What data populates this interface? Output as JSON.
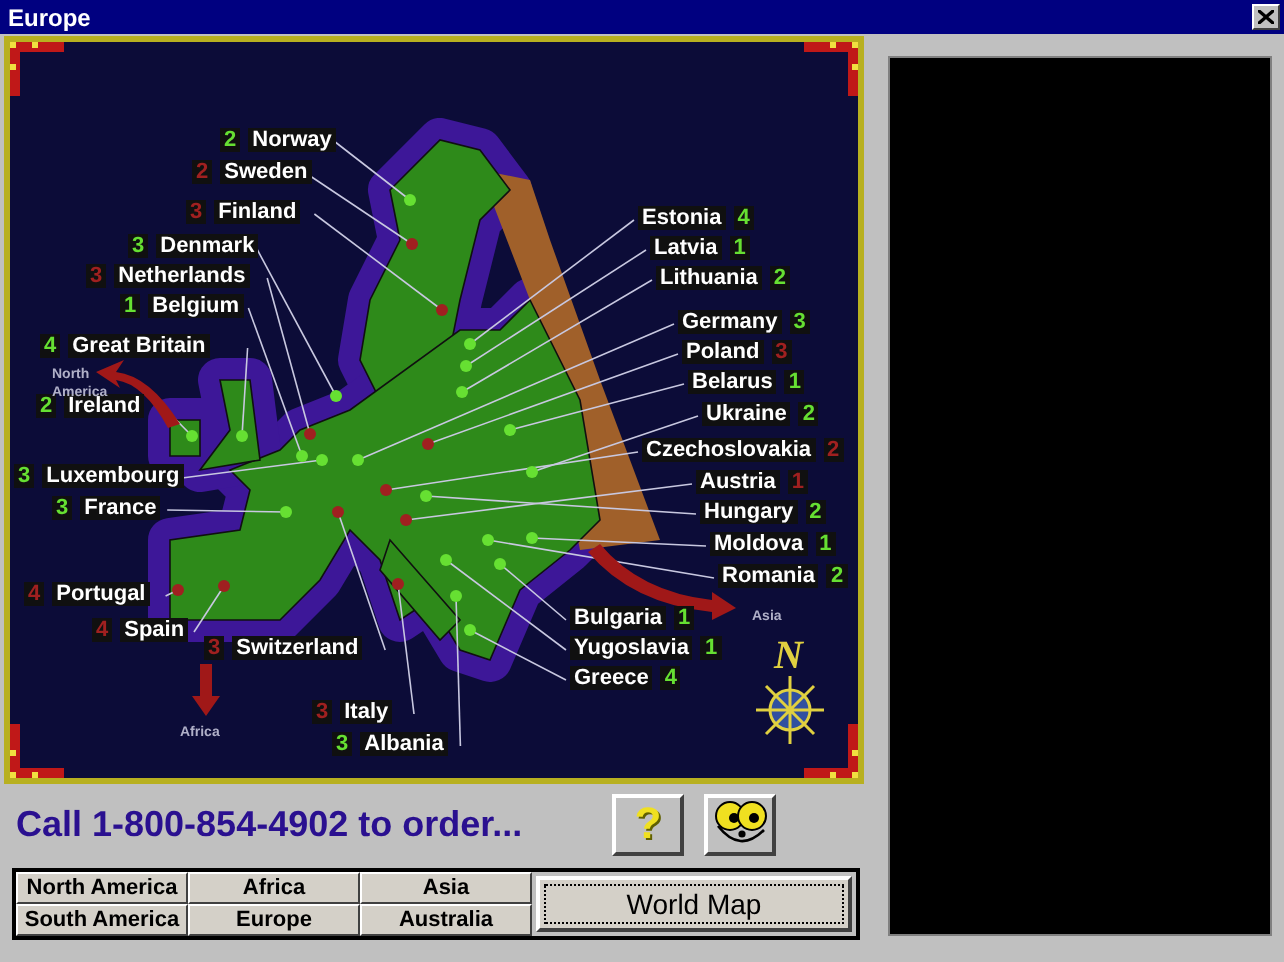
{
  "window": {
    "title": "Europe"
  },
  "map": {
    "countries": [
      {
        "name": "Norway",
        "count": "2",
        "color": "#66e032"
      },
      {
        "name": "Sweden",
        "count": "2",
        "color": "#a02020"
      },
      {
        "name": "Finland",
        "count": "3",
        "color": "#a02020"
      },
      {
        "name": "Denmark",
        "count": "3",
        "color": "#66e032"
      },
      {
        "name": "Netherlands",
        "count": "3",
        "color": "#a02020"
      },
      {
        "name": "Belgium",
        "count": "1",
        "color": "#66e032"
      },
      {
        "name": "Great Britain",
        "count": "4",
        "color": "#66e032"
      },
      {
        "name": "Ireland",
        "count": "2",
        "color": "#66e032"
      },
      {
        "name": "Luxembourg",
        "count": "3",
        "color": "#66e032"
      },
      {
        "name": "France",
        "count": "3",
        "color": "#66e032"
      },
      {
        "name": "Portugal",
        "count": "4",
        "color": "#a02020"
      },
      {
        "name": "Spain",
        "count": "4",
        "color": "#a02020"
      },
      {
        "name": "Switzerland",
        "count": "3",
        "color": "#a02020"
      },
      {
        "name": "Italy",
        "count": "3",
        "color": "#a02020"
      },
      {
        "name": "Albania",
        "count": "3",
        "color": "#66e032"
      },
      {
        "name": "Estonia",
        "count": "4",
        "color": "#66e032"
      },
      {
        "name": "Latvia",
        "count": "1",
        "color": "#66e032"
      },
      {
        "name": "Lithuania",
        "count": "2",
        "color": "#66e032"
      },
      {
        "name": "Germany",
        "count": "3",
        "color": "#66e032"
      },
      {
        "name": "Poland",
        "count": "3",
        "color": "#a02020"
      },
      {
        "name": "Belarus",
        "count": "1",
        "color": "#66e032"
      },
      {
        "name": "Ukraine",
        "count": "2",
        "color": "#66e032"
      },
      {
        "name": "Czechoslovakia",
        "count": "2",
        "color": "#a02020"
      },
      {
        "name": "Austria",
        "count": "1",
        "color": "#a02020"
      },
      {
        "name": "Hungary",
        "count": "2",
        "color": "#66e032"
      },
      {
        "name": "Moldova",
        "count": "1",
        "color": "#66e032"
      },
      {
        "name": "Romania",
        "count": "2",
        "color": "#66e032"
      },
      {
        "name": "Bulgaria",
        "count": "1",
        "color": "#66e032"
      },
      {
        "name": "Yugoslavia",
        "count": "1",
        "color": "#66e032"
      },
      {
        "name": "Greece",
        "count": "4",
        "color": "#66e032"
      }
    ],
    "arrows": [
      {
        "kind": "west",
        "label": "North America"
      },
      {
        "kind": "south",
        "label": "Africa"
      },
      {
        "kind": "east",
        "label": "Asia"
      }
    ],
    "compass_letter": "N"
  },
  "order_text": "Call 1-800-854-4902 to order...",
  "help_button": "?",
  "continents": [
    "North America",
    "Africa",
    "Asia",
    "South America",
    "Europe",
    "Australia"
  ],
  "world_map_button": "World Map"
}
